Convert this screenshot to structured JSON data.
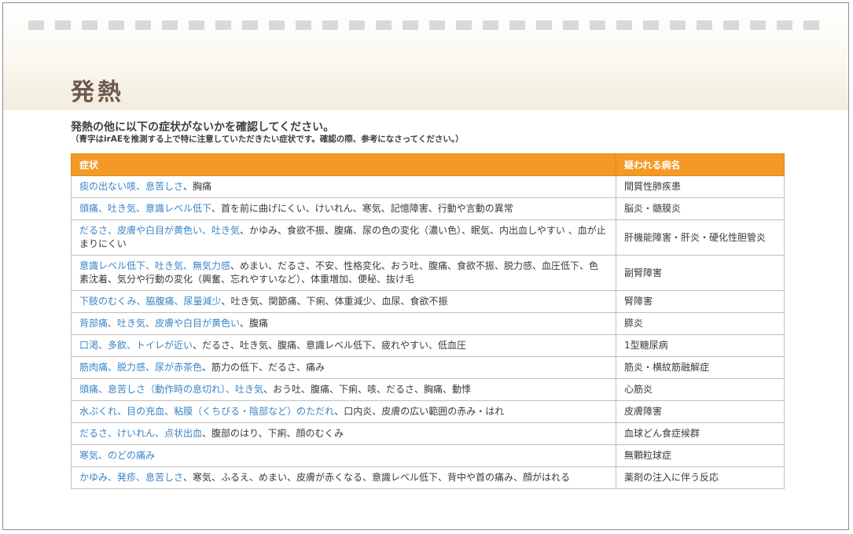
{
  "page": {
    "title": "発熱",
    "intro": "発熱の他に以下の症状がないかを確認してください。",
    "note": "（青字はirAEを推測する上で特に注意していただきたい症状です。確認の際、参考になさってください。）"
  },
  "colors": {
    "header_orange": "#f39a26",
    "emphasis_blue": "#3a84c6",
    "title_brown": "#6b5a4b"
  },
  "table": {
    "headers": [
      "症状",
      "疑われる病名"
    ],
    "rows": [
      {
        "blue": "痰の出ない咳、息苦しさ",
        "rest": "、胸痛",
        "disease": "間質性肺疾患"
      },
      {
        "blue": "頭痛、吐き気、意識レベル低下",
        "rest": "、首を前に曲げにくい、けいれん、寒気、記憶障害、行動や言動の異常",
        "disease": "脳炎・髄膜炎"
      },
      {
        "blue": "だるさ、皮膚や白目が黄色い、吐き気",
        "rest": "、かゆみ、食欲不振、腹痛、尿の色の変化（濃い色）、眠気、内出血しやすい 、血が止まりにくい",
        "disease": "肝機能障害・肝炎・硬化性胆管炎"
      },
      {
        "blue": "意識レベル低下、吐き気、無気力感",
        "rest": "、めまい、だるさ、不安、性格変化、おう吐、腹痛、食欲不振、脱力感、血圧低下、色素沈着、気分や行動の変化（興奮、忘れやすいなど）、体重増加、便秘、抜け毛",
        "disease": "副腎障害"
      },
      {
        "blue": "下肢のむくみ、脇腹痛、尿量減少",
        "rest": "、吐き気、関節痛、下痢、体重減少、血尿、食欲不振",
        "disease": "腎障害"
      },
      {
        "blue": "背部痛、吐き気、皮膚や白目が黄色い",
        "rest": "、腹痛",
        "disease": "膵炎"
      },
      {
        "blue": "口渇、多飲、トイレが近い",
        "rest": "、だるさ、吐き気、腹痛、意識レベル低下、疲れやすい、低血圧",
        "disease": "1型糖尿病"
      },
      {
        "blue": "筋肉痛、脱力感、尿が赤茶色",
        "rest": "、筋力の低下、だるさ、痛み",
        "disease": "筋炎・横紋筋融解症"
      },
      {
        "blue": "頭痛、息苦しさ（動作時の息切れ）、吐き気",
        "rest": "、おう吐、腹痛、下痢、咳、だるさ、胸痛、動悸",
        "disease": "心筋炎"
      },
      {
        "blue": "水ぶくれ、目の充血、粘膜（くちびる・陰部など）のただれ",
        "rest": "、口内炎、皮膚の広い範囲の赤み・はれ",
        "disease": "皮膚障害"
      },
      {
        "blue": "だるさ、けいれん、点状出血",
        "rest": "、腹部のはり、下痢、顔のむくみ",
        "disease": "血球どん食症候群"
      },
      {
        "blue": "寒気、のどの痛み",
        "rest": "",
        "disease": "無顆粒球症"
      },
      {
        "blue": "かゆみ、発疹、息苦しさ",
        "rest": "、寒気、ふるえ、めまい、皮膚が赤くなる、意識レベル低下、背中や首の痛み、顔がはれる",
        "disease": "薬剤の注入に伴う反応"
      }
    ]
  }
}
